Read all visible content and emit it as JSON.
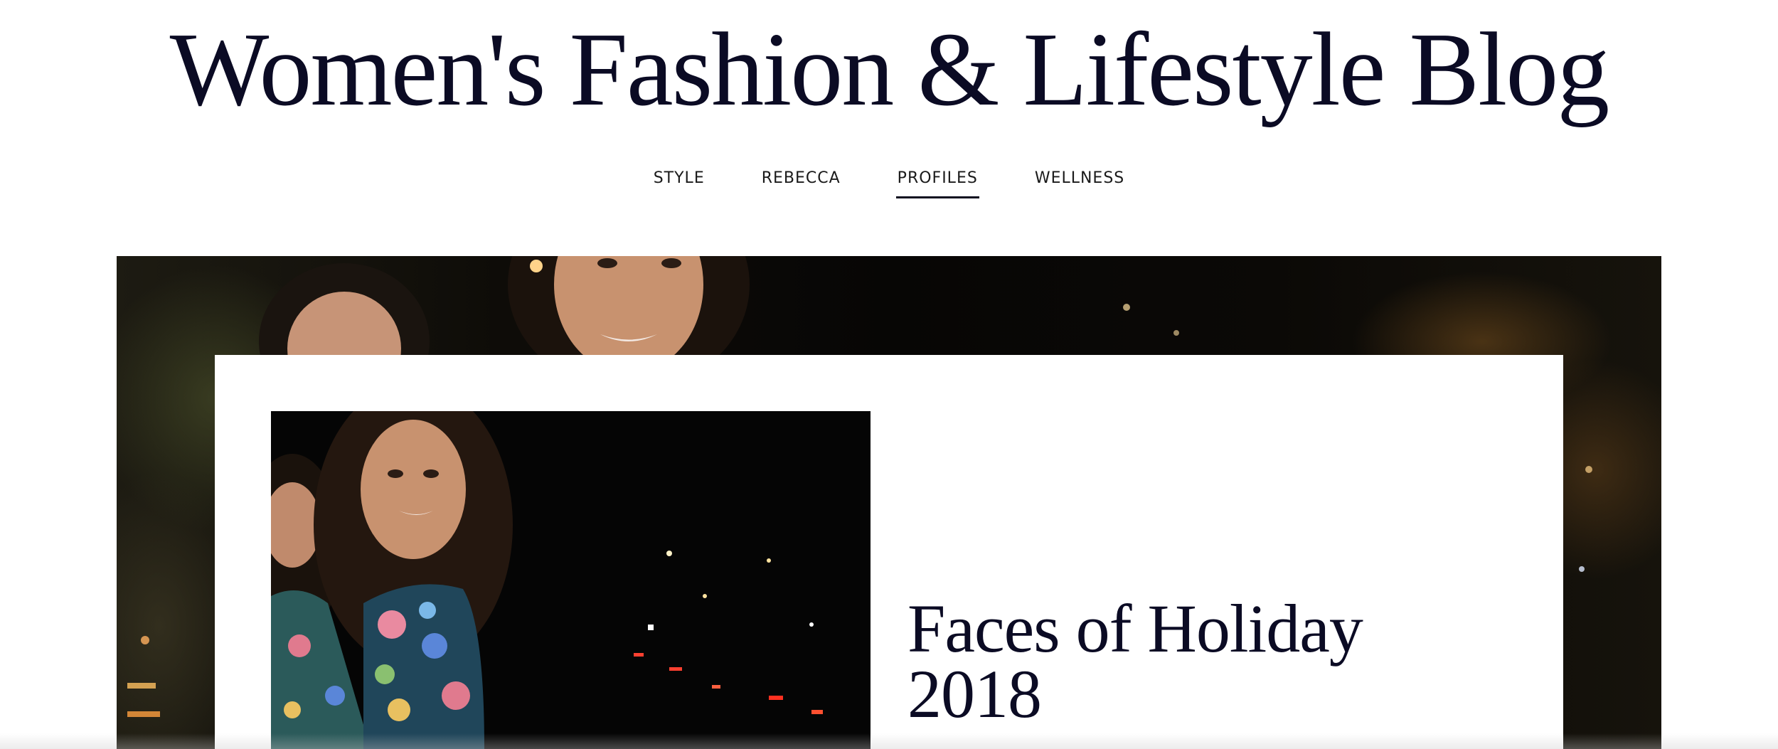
{
  "site": {
    "title": "Women's Fashion & Lifestyle Blog"
  },
  "nav": {
    "items": [
      {
        "label": "STYLE",
        "active": false
      },
      {
        "label": "REBECCA",
        "active": false
      },
      {
        "label": "PROFILES",
        "active": true
      },
      {
        "label": "WELLNESS",
        "active": false
      }
    ]
  },
  "featured": {
    "title_line1": "Faces of Holiday",
    "title_line2": "2018"
  },
  "colors": {
    "title_text": "#0b0b24",
    "nav_text": "#1a1a1a",
    "active_underline": "#0b0b1f",
    "hero_background": "#070605"
  }
}
